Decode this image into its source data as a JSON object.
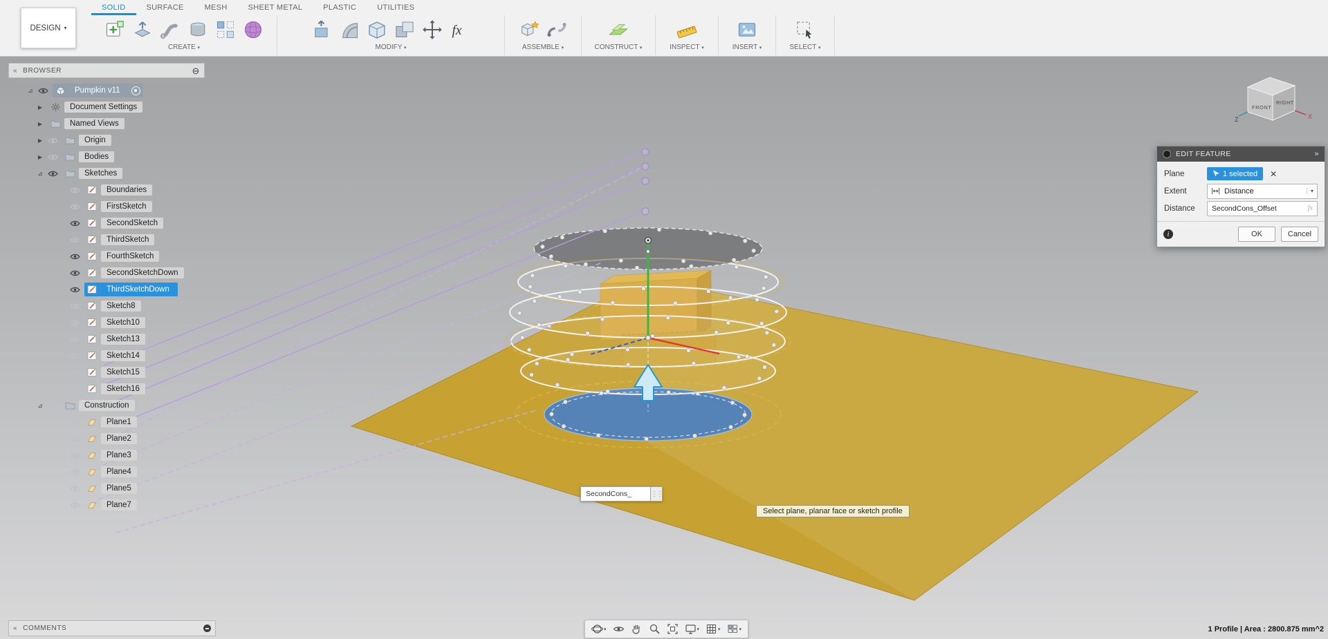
{
  "glyphs": {
    "caret_down": "▾",
    "collapse_left": "«",
    "double_right": "»",
    "minus_circle": "⊖",
    "clear": "✕",
    "info": "i",
    "grip": "⋮⋮",
    "expanded_arrow": "⊿",
    "collapsed_arrow": "▶"
  },
  "app": {
    "design_menu": {
      "label": "DESIGN"
    },
    "tabs": [
      {
        "label": "SOLID",
        "active": true
      },
      {
        "label": "SURFACE"
      },
      {
        "label": "MESH"
      },
      {
        "label": "SHEET METAL"
      },
      {
        "label": "PLASTIC"
      },
      {
        "label": "UTILITIES"
      }
    ],
    "ribbon_groups": [
      {
        "label": "CREATE",
        "icons": [
          "create-sketch",
          "extrude",
          "sweep",
          "revolve",
          "pattern",
          "create-form"
        ]
      },
      {
        "label": "MODIFY",
        "icons": [
          "press-pull",
          "fillet",
          "shell",
          "combine",
          "move",
          "parameters-fx"
        ]
      },
      {
        "label": "ASSEMBLE",
        "icons": [
          "new-component",
          "joint"
        ]
      },
      {
        "label": "CONSTRUCT",
        "icons": [
          "construction-plane"
        ]
      },
      {
        "label": "INSPECT",
        "icons": [
          "measure"
        ]
      },
      {
        "label": "INSERT",
        "icons": [
          "insert-canvas"
        ]
      },
      {
        "label": "SELECT",
        "icons": [
          "select-window"
        ]
      }
    ]
  },
  "browser": {
    "header_label": "BROWSER",
    "tree": [
      {
        "label": "Pumpkin v11",
        "level": 0,
        "type": "component",
        "root": true,
        "expanded": true
      },
      {
        "label": "Document Settings",
        "level": 1,
        "type": "settings",
        "collapsible": true
      },
      {
        "label": "Named Views",
        "level": 1,
        "type": "folder",
        "collapsible": true
      },
      {
        "label": "Origin",
        "level": 1,
        "type": "folder",
        "collapsible": true,
        "eye": false
      },
      {
        "label": "Bodies",
        "level": 1,
        "type": "folder",
        "collapsible": true,
        "eye": false
      },
      {
        "label": "Sketches",
        "level": 1,
        "type": "folder",
        "expanded": true,
        "eye": true
      },
      {
        "label": "Boundaries",
        "level": 2,
        "type": "sketch",
        "eye": false
      },
      {
        "label": "FirstSketch",
        "level": 2,
        "type": "sketch",
        "eye": false
      },
      {
        "label": "SecondSketch",
        "level": 2,
        "type": "sketch",
        "eye": true
      },
      {
        "label": "ThirdSketch",
        "level": 2,
        "type": "sketch",
        "eye": false
      },
      {
        "label": "FourthSketch",
        "level": 2,
        "type": "sketch",
        "eye": true
      },
      {
        "label": "SecondSketchDown",
        "level": 2,
        "type": "sketch",
        "eye": true
      },
      {
        "label": "ThirdSketchDown",
        "level": 2,
        "type": "sketch",
        "eye": true,
        "selected": true
      },
      {
        "label": "Sketch8",
        "level": 2,
        "type": "sketch",
        "eye": false
      },
      {
        "label": "Sketch10",
        "level": 2,
        "type": "sketch",
        "eye": false
      },
      {
        "label": "Sketch13",
        "level": 2,
        "type": "sketch",
        "eye": false
      },
      {
        "label": "Sketch14",
        "level": 2,
        "type": "sketch",
        "eye": false
      },
      {
        "label": "Sketch15",
        "level": 2,
        "type": "sketch",
        "eye": false
      },
      {
        "label": "Sketch16",
        "level": 2,
        "type": "sketch",
        "eye": false
      },
      {
        "label": "Construction",
        "level": 1,
        "type": "folder",
        "expanded": true,
        "eye": false
      },
      {
        "label": "Plane1",
        "level": 2,
        "type": "plane",
        "eye": false
      },
      {
        "label": "Plane2",
        "level": 2,
        "type": "plane",
        "eye": false
      },
      {
        "label": "Plane3",
        "level": 2,
        "type": "plane",
        "eye": false
      },
      {
        "label": "Plane4",
        "level": 2,
        "type": "plane",
        "eye": false
      },
      {
        "label": "Plane5",
        "level": 2,
        "type": "plane",
        "eye": false
      },
      {
        "label": "Plane7",
        "level": 2,
        "type": "plane",
        "eye": false
      }
    ]
  },
  "edit_feature": {
    "title": "EDIT FEATURE",
    "plane_label": "Plane",
    "plane_value": "1 selected",
    "extent_label": "Extent",
    "extent_value": "Distance",
    "distance_label": "Distance",
    "distance_value": "SecondCons_Offset",
    "fx_label": "fx",
    "ok_label": "OK",
    "cancel_label": "Cancel"
  },
  "viewport": {
    "floating_input_value": "SecondCons_",
    "tooltip": "Select plane, planar face or sketch profile",
    "status_text": "1 Profile | Area : 2800.875 mm^2",
    "viewcube": {
      "front_label": "FRONT",
      "right_label": "RIGHT",
      "z_label": "Z",
      "x_label": "X"
    },
    "colors": {
      "ground_plane": "#c7a232",
      "base_disc": "#4b80c2",
      "selection_purple": "#b79ce0",
      "axis_green": "#3bb54a",
      "axis_red": "#e03c31",
      "axis_blue": "#2b5fd9",
      "accent_blue": "#0696d7"
    }
  },
  "comments": {
    "header_label": "COMMENTS"
  },
  "nav_toolbar": {
    "items": [
      {
        "icon": "orbit",
        "caret": true
      },
      {
        "icon": "look-at",
        "caret": false
      },
      {
        "icon": "pan",
        "caret": false
      },
      {
        "icon": "zoom",
        "caret": false
      },
      {
        "icon": "fit",
        "caret": false
      },
      {
        "icon": "display-settings",
        "caret": true
      },
      {
        "icon": "grid-settings",
        "caret": true
      },
      {
        "icon": "viewports",
        "caret": true
      }
    ]
  }
}
